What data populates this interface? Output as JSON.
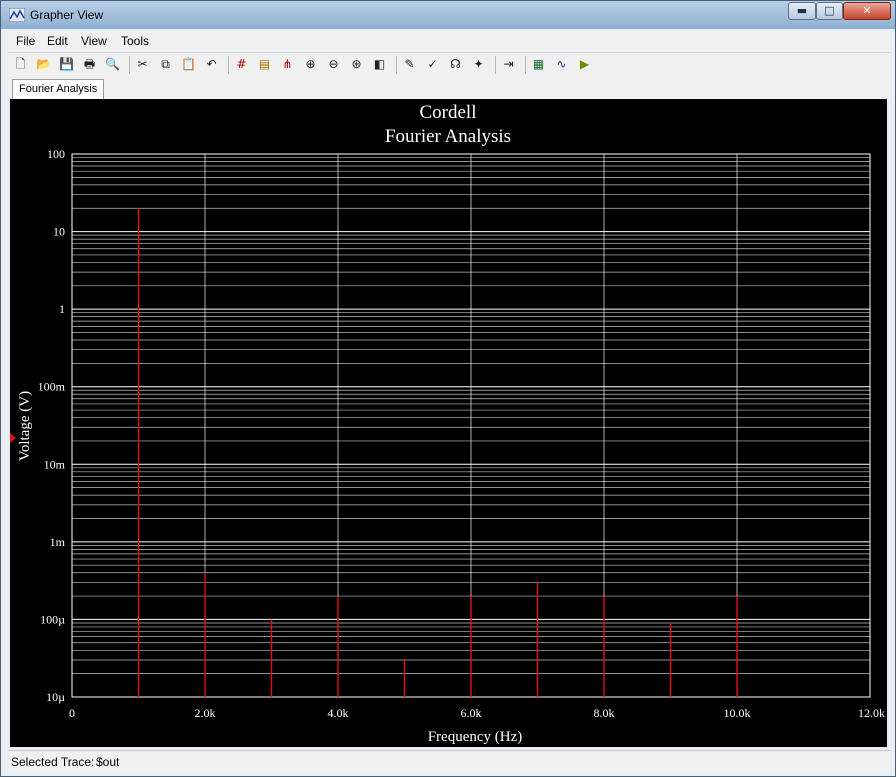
{
  "window": {
    "title": "Grapher View"
  },
  "titlebar_buttons": {
    "minimize": "▬",
    "maximize": "□",
    "close": "✕"
  },
  "menu": [
    {
      "label": "File"
    },
    {
      "label": "Edit"
    },
    {
      "label": "View"
    },
    {
      "label": "Tools"
    }
  ],
  "toolbar": [
    {
      "name": "new-icon",
      "glyph": "🗋"
    },
    {
      "name": "open-icon",
      "glyph": "📂"
    },
    {
      "name": "save-icon",
      "glyph": "💾"
    },
    {
      "name": "print-icon",
      "glyph": "🖶"
    },
    {
      "name": "print-preview-icon",
      "glyph": "🔍"
    },
    {
      "name": "separator"
    },
    {
      "name": "cut-icon",
      "glyph": "✂"
    },
    {
      "name": "copy-icon",
      "glyph": "⧉"
    },
    {
      "name": "paste-icon",
      "glyph": "📋"
    },
    {
      "name": "undo-icon",
      "glyph": "↶"
    },
    {
      "name": "separator"
    },
    {
      "name": "toggle-grid-icon",
      "glyph": "#",
      "color": "#c00000"
    },
    {
      "name": "toggle-legend-icon",
      "glyph": "▤",
      "color": "#a07000"
    },
    {
      "name": "toggle-cursors-icon",
      "glyph": "⋔",
      "color": "#c00000"
    },
    {
      "name": "zoom-in-icon",
      "glyph": "⊕"
    },
    {
      "name": "zoom-out-icon",
      "glyph": "⊖"
    },
    {
      "name": "zoom-full-icon",
      "glyph": "⊛"
    },
    {
      "name": "reverse-colors-icon",
      "glyph": "◧"
    },
    {
      "name": "separator"
    },
    {
      "name": "show-select-marks-icon",
      "glyph": "✎"
    },
    {
      "name": "select-marks-icon",
      "glyph": "✓"
    },
    {
      "name": "trace-icon",
      "glyph": "☊"
    },
    {
      "name": "cursor-icon",
      "glyph": "✦"
    },
    {
      "name": "separator"
    },
    {
      "name": "export-icon",
      "glyph": "⇥"
    },
    {
      "name": "separator"
    },
    {
      "name": "export-excel-icon",
      "glyph": "▦",
      "color": "#1a6e2e"
    },
    {
      "name": "export-mathcad-icon",
      "glyph": "∿",
      "color": "#1a3a8a"
    },
    {
      "name": "export-labview-icon",
      "glyph": "▶",
      "color": "#6b8e00"
    }
  ],
  "tabs": [
    {
      "label": "Fourier Analysis"
    }
  ],
  "chart_data": {
    "type": "bar",
    "title": "Cordell",
    "subtitle": "Fourier Analysis",
    "xlabel": "Frequency (Hz)",
    "ylabel": "Voltage (V)",
    "xlim": [
      0,
      12000
    ],
    "ylim": [
      1e-05,
      100
    ],
    "y_scale": "log",
    "x_ticks": [
      {
        "value": 0,
        "label": "0"
      },
      {
        "value": 2000,
        "label": "2.0k"
      },
      {
        "value": 4000,
        "label": "4.0k"
      },
      {
        "value": 6000,
        "label": "6.0k"
      },
      {
        "value": 8000,
        "label": "8.0k"
      },
      {
        "value": 10000,
        "label": "10.0k"
      },
      {
        "value": 12000,
        "label": "12.0k"
      }
    ],
    "y_ticks": [
      {
        "value": 1e-05,
        "label": "10µ"
      },
      {
        "value": 0.0001,
        "label": "100µ"
      },
      {
        "value": 0.001,
        "label": "1m"
      },
      {
        "value": 0.01,
        "label": "10m"
      },
      {
        "value": 0.1,
        "label": "100m"
      },
      {
        "value": 1,
        "label": "1"
      },
      {
        "value": 10,
        "label": "10"
      },
      {
        "value": 100,
        "label": "100"
      }
    ],
    "grid": true,
    "background": "#000000",
    "grid_color": "#ffffff",
    "series": [
      {
        "color": "#e01010",
        "x": [
          1000,
          2000,
          3000,
          4000,
          5000,
          6000,
          7000,
          8000,
          9000,
          10000
        ],
        "values": [
          20,
          0.0004,
          0.0001,
          0.0002,
          3e-05,
          0.0002,
          0.0003,
          0.0002,
          9e-05,
          0.0002
        ]
      }
    ]
  },
  "status": {
    "label": "Selected Trace:",
    "value": "$out"
  }
}
